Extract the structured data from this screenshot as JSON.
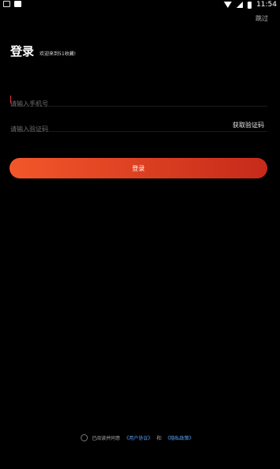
{
  "status_bar": {
    "time": "11:54",
    "icons": [
      "notification-icon",
      "sim-icon",
      "wifi-icon",
      "signal-icon",
      "battery-icon"
    ]
  },
  "header": {
    "skip_label": "跳过",
    "title": "登录",
    "subtitle": "欢迎来到51收藏!"
  },
  "form": {
    "phone_placeholder": "请输入手机号",
    "code_placeholder": "请输入验证码",
    "get_code_label": "获取验证码"
  },
  "login_button": {
    "label": "登录",
    "gradient_start": "#f2572a",
    "gradient_end": "#c62a1a"
  },
  "agreement": {
    "prefix": "已阅读并同意",
    "user_agreement": "《用户协议》",
    "and": "和",
    "privacy_policy": "《隐私政策》",
    "link_color": "#5aa3ff"
  }
}
